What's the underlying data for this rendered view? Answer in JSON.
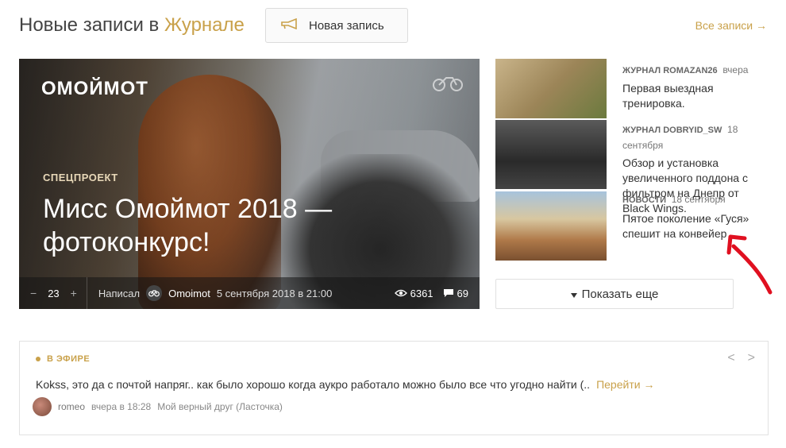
{
  "header": {
    "title_prefix": "Новые записи в ",
    "title_accent": "Журнале",
    "new_post_label": "Новая запись",
    "all_posts_label": "Все записи →"
  },
  "feature": {
    "logo": "ОМОЙМОТ",
    "tag": "СПЕЦПРОЕКТ",
    "title": "Мисс Омоймот 2018 — фотоконкурс!",
    "vote_minus": "−",
    "vote_count": "23",
    "vote_plus": "+",
    "written_by_label": "Написал",
    "author": "Omoimot",
    "date": "5 сентября 2018 в 21:00",
    "views": "6361",
    "comments": "69"
  },
  "side": {
    "items": [
      {
        "source": "ЖУРНАЛ ROMAZAN26",
        "time": "вчера",
        "text": "Первая выездная тренировка."
      },
      {
        "source": "ЖУРНАЛ DOBRYID_SW",
        "time": "18 сентября",
        "text": "Обзор и установка увеличенного поддона с фильтром на Днепр от Black Wings."
      },
      {
        "source": "НОВОСТИ",
        "time": "18 сентября",
        "text": "Пятое поколение «Гуся» спешит на конвейер"
      }
    ],
    "more_label": "Показать еще"
  },
  "live": {
    "label": "В ЭФИРЕ",
    "prev": "<",
    "next": ">",
    "message": "Kokss, это да с почтой напряг..  как было хорошо когда аукро работало можно было все что угодно найти (..",
    "go_label": "Перейти →",
    "user": "romeo",
    "time": "вчера в 18:28",
    "topic": "Мой верный друг (Ласточка)"
  }
}
